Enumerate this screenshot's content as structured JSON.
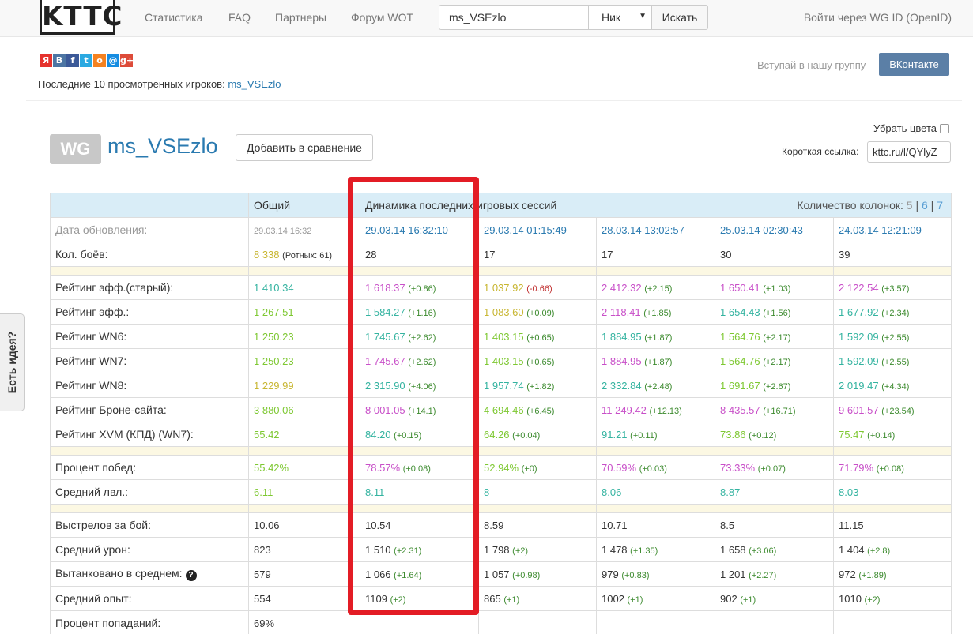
{
  "nav": {
    "logo": "KTTC",
    "links": [
      "Статистика",
      "FAQ",
      "Партнеры",
      "Форум WOT"
    ],
    "search_value": "ms_VSEzlo",
    "search_type": "Ник",
    "search_button": "Искать",
    "login": "Войти через WG ID (OpenID)"
  },
  "share_icons": [
    {
      "name": "yandex-icon",
      "glyph": "Я",
      "color": "#e5322d"
    },
    {
      "name": "vk-icon",
      "glyph": "В",
      "color": "#4c75a3"
    },
    {
      "name": "facebook-icon",
      "glyph": "f",
      "color": "#3b5998"
    },
    {
      "name": "twitter-icon",
      "glyph": "t",
      "color": "#2ba9e1"
    },
    {
      "name": "odnoklassniki-icon",
      "glyph": "о",
      "color": "#f58220"
    },
    {
      "name": "mailru-icon",
      "glyph": "@",
      "color": "#168de2"
    },
    {
      "name": "googleplus-icon",
      "glyph": "g+",
      "color": "#dd4b39"
    }
  ],
  "recent": {
    "label": "Последние 10 просмотренных игроков:",
    "player": "ms_VSEzlo"
  },
  "group": {
    "text": "Вступай в нашу группу",
    "button": "ВКонтакте"
  },
  "player": {
    "badge": "WG",
    "name": "ms_VSEzlo",
    "compare_button": "Добавить в сравнение",
    "remove_colors": "Убрать цвета",
    "short_link_label": "Короткая ссылка:",
    "short_link_value": "kttc.ru/l/QYlyZ"
  },
  "side_tab": "Есть идея?",
  "table": {
    "header": {
      "total": "Общий",
      "dynamics": "Динамика последних игровых сессий",
      "columns_label": "Количество колонок:",
      "column_options": [
        "5",
        "6",
        "7"
      ]
    },
    "rows": [
      {
        "label": "Дата обновления:",
        "lclass": "c-muted",
        "cells": [
          {
            "v": "29.03.14 16:32",
            "c": "c-muted"
          },
          {
            "v": "29.03.14 16:32:10",
            "c": "c-blue"
          },
          {
            "v": "29.03.14 01:15:49",
            "c": "c-blue"
          },
          {
            "v": "28.03.14 13:02:57",
            "c": "c-blue"
          },
          {
            "v": "25.03.14 02:30:43",
            "c": "c-blue"
          },
          {
            "v": "24.03.14 12:21:09",
            "c": "c-blue"
          }
        ]
      },
      {
        "label": "Кол. боёв:",
        "cells": [
          {
            "v": "8 338",
            "c": "c-yellow",
            "sub": "(Ротных: 61)"
          },
          {
            "v": "28",
            "c": "c-dark"
          },
          {
            "v": "17",
            "c": "c-dark"
          },
          {
            "v": "17",
            "c": "c-dark"
          },
          {
            "v": "30",
            "c": "c-dark"
          },
          {
            "v": "39",
            "c": "c-dark"
          }
        ]
      },
      {
        "spacer": true
      },
      {
        "label": "Рейтинг эфф.(старый):",
        "cells": [
          {
            "v": "1 410.34",
            "c": "c-teal"
          },
          {
            "v": "1 618.37",
            "c": "c-purple",
            "d": "(+0.86)"
          },
          {
            "v": "1 037.92",
            "c": "c-yellow",
            "d": "(-0.66)",
            "neg": true
          },
          {
            "v": "2 412.32",
            "c": "c-purple",
            "d": "(+2.15)"
          },
          {
            "v": "1 650.41",
            "c": "c-purple",
            "d": "(+1.03)"
          },
          {
            "v": "2 122.54",
            "c": "c-purple",
            "d": "(+3.57)"
          }
        ]
      },
      {
        "label": "Рейтинг эфф.:",
        "cells": [
          {
            "v": "1 267.51",
            "c": "c-green"
          },
          {
            "v": "1 584.27",
            "c": "c-teal",
            "d": "(+1.16)"
          },
          {
            "v": "1 083.60",
            "c": "c-yellow",
            "d": "(+0.09)"
          },
          {
            "v": "2 118.41",
            "c": "c-purple",
            "d": "(+1.85)"
          },
          {
            "v": "1 654.43",
            "c": "c-teal",
            "d": "(+1.56)"
          },
          {
            "v": "1 677.92",
            "c": "c-teal",
            "d": "(+2.34)"
          }
        ]
      },
      {
        "label": "Рейтинг WN6:",
        "cells": [
          {
            "v": "1 250.23",
            "c": "c-green"
          },
          {
            "v": "1 745.67",
            "c": "c-teal",
            "d": "(+2.62)"
          },
          {
            "v": "1 403.15",
            "c": "c-green",
            "d": "(+0.65)"
          },
          {
            "v": "1 884.95",
            "c": "c-teal",
            "d": "(+1.87)"
          },
          {
            "v": "1 564.76",
            "c": "c-green",
            "d": "(+2.17)"
          },
          {
            "v": "1 592.09",
            "c": "c-teal",
            "d": "(+2.55)"
          }
        ]
      },
      {
        "label": "Рейтинг WN7:",
        "cells": [
          {
            "v": "1 250.23",
            "c": "c-green"
          },
          {
            "v": "1 745.67",
            "c": "c-purple",
            "d": "(+2.62)"
          },
          {
            "v": "1 403.15",
            "c": "c-green",
            "d": "(+0.65)"
          },
          {
            "v": "1 884.95",
            "c": "c-purple",
            "d": "(+1.87)"
          },
          {
            "v": "1 564.76",
            "c": "c-green",
            "d": "(+2.17)"
          },
          {
            "v": "1 592.09",
            "c": "c-teal",
            "d": "(+2.55)"
          }
        ]
      },
      {
        "label": "Рейтинг WN8:",
        "cells": [
          {
            "v": "1 229.99",
            "c": "c-yellow"
          },
          {
            "v": "2 315.90",
            "c": "c-teal",
            "d": "(+4.06)"
          },
          {
            "v": "1 957.74",
            "c": "c-teal",
            "d": "(+1.82)"
          },
          {
            "v": "2 332.84",
            "c": "c-teal",
            "d": "(+2.48)"
          },
          {
            "v": "1 691.67",
            "c": "c-green",
            "d": "(+2.67)"
          },
          {
            "v": "2 019.47",
            "c": "c-teal",
            "d": "(+4.34)"
          }
        ]
      },
      {
        "label": "Рейтинг Броне-сайта:",
        "cells": [
          {
            "v": "3 880.06",
            "c": "c-green"
          },
          {
            "v": "8 001.05",
            "c": "c-purple",
            "d": "(+14.1)"
          },
          {
            "v": "4 694.46",
            "c": "c-green",
            "d": "(+6.45)"
          },
          {
            "v": "11 249.42",
            "c": "c-purple",
            "d": "(+12.13)"
          },
          {
            "v": "8 435.57",
            "c": "c-purple",
            "d": "(+16.71)"
          },
          {
            "v": "9 601.57",
            "c": "c-purple",
            "d": "(+23.54)"
          }
        ]
      },
      {
        "label": "Рейтинг XVM (КПД) (WN7):",
        "cells": [
          {
            "v": "55.42",
            "c": "c-green"
          },
          {
            "v": "84.20",
            "c": "c-teal",
            "d": "(+0.15)"
          },
          {
            "v": "64.26",
            "c": "c-green",
            "d": "(+0.04)"
          },
          {
            "v": "91.21",
            "c": "c-teal",
            "d": "(+0.11)"
          },
          {
            "v": "73.86",
            "c": "c-green",
            "d": "(+0.12)"
          },
          {
            "v": "75.47",
            "c": "c-green",
            "d": "(+0.14)"
          }
        ]
      },
      {
        "spacer": true
      },
      {
        "label": "Процент побед:",
        "cells": [
          {
            "v": "55.42%",
            "c": "c-green"
          },
          {
            "v": "78.57%",
            "c": "c-purple",
            "d": "(+0.08)"
          },
          {
            "v": "52.94%",
            "c": "c-green",
            "d": "(+0)"
          },
          {
            "v": "70.59%",
            "c": "c-purple",
            "d": "(+0.03)"
          },
          {
            "v": "73.33%",
            "c": "c-purple",
            "d": "(+0.07)"
          },
          {
            "v": "71.79%",
            "c": "c-purple",
            "d": "(+0.08)"
          }
        ]
      },
      {
        "label": "Средний лвл.:",
        "cells": [
          {
            "v": "6.11",
            "c": "c-green"
          },
          {
            "v": "8.11",
            "c": "c-teal"
          },
          {
            "v": "8",
            "c": "c-teal"
          },
          {
            "v": "8.06",
            "c": "c-teal"
          },
          {
            "v": "8.87",
            "c": "c-teal"
          },
          {
            "v": "8.03",
            "c": "c-teal"
          }
        ]
      },
      {
        "spacer": true
      },
      {
        "label": "Выстрелов за бой:",
        "cells": [
          {
            "v": "10.06",
            "c": "c-dark"
          },
          {
            "v": "10.54",
            "c": "c-dark"
          },
          {
            "v": "8.59",
            "c": "c-dark"
          },
          {
            "v": "10.71",
            "c": "c-dark"
          },
          {
            "v": "8.5",
            "c": "c-dark"
          },
          {
            "v": "11.15",
            "c": "c-dark"
          }
        ]
      },
      {
        "label": "Средний урон:",
        "cells": [
          {
            "v": "823",
            "c": "c-dark"
          },
          {
            "v": "1 510",
            "c": "c-dark",
            "d": "(+2.31)"
          },
          {
            "v": "1 798",
            "c": "c-dark",
            "d": "(+2)"
          },
          {
            "v": "1 478",
            "c": "c-dark",
            "d": "(+1.35)"
          },
          {
            "v": "1 658",
            "c": "c-dark",
            "d": "(+3.06)"
          },
          {
            "v": "1 404",
            "c": "c-dark",
            "d": "(+2.8)"
          }
        ]
      },
      {
        "label": "Вытанковано в среднем:",
        "help": "?",
        "cells": [
          {
            "v": "579",
            "c": "c-dark"
          },
          {
            "v": "1 066",
            "c": "c-dark",
            "d": "(+1.64)"
          },
          {
            "v": "1 057",
            "c": "c-dark",
            "d": "(+0.98)"
          },
          {
            "v": "979",
            "c": "c-dark",
            "d": "(+0.83)"
          },
          {
            "v": "1 201",
            "c": "c-dark",
            "d": "(+2.27)"
          },
          {
            "v": "972",
            "c": "c-dark",
            "d": "(+1.89)"
          }
        ]
      },
      {
        "label": "Средний опыт:",
        "cells": [
          {
            "v": "554",
            "c": "c-dark"
          },
          {
            "v": "1109",
            "c": "c-dark",
            "d": "(+2)"
          },
          {
            "v": "865",
            "c": "c-dark",
            "d": "(+1)"
          },
          {
            "v": "1002",
            "c": "c-dark",
            "d": "(+1)"
          },
          {
            "v": "902",
            "c": "c-dark",
            "d": "(+1)"
          },
          {
            "v": "1010",
            "c": "c-dark",
            "d": "(+2)"
          }
        ]
      },
      {
        "label": "Процент попаданий:",
        "cells": [
          {
            "v": "69%",
            "c": "c-dark"
          },
          {
            "v": "",
            "c": "c-dark"
          },
          {
            "v": "",
            "c": "c-dark"
          },
          {
            "v": "",
            "c": "c-dark"
          },
          {
            "v": "",
            "c": "c-dark"
          },
          {
            "v": "",
            "c": "c-dark"
          }
        ]
      }
    ]
  }
}
